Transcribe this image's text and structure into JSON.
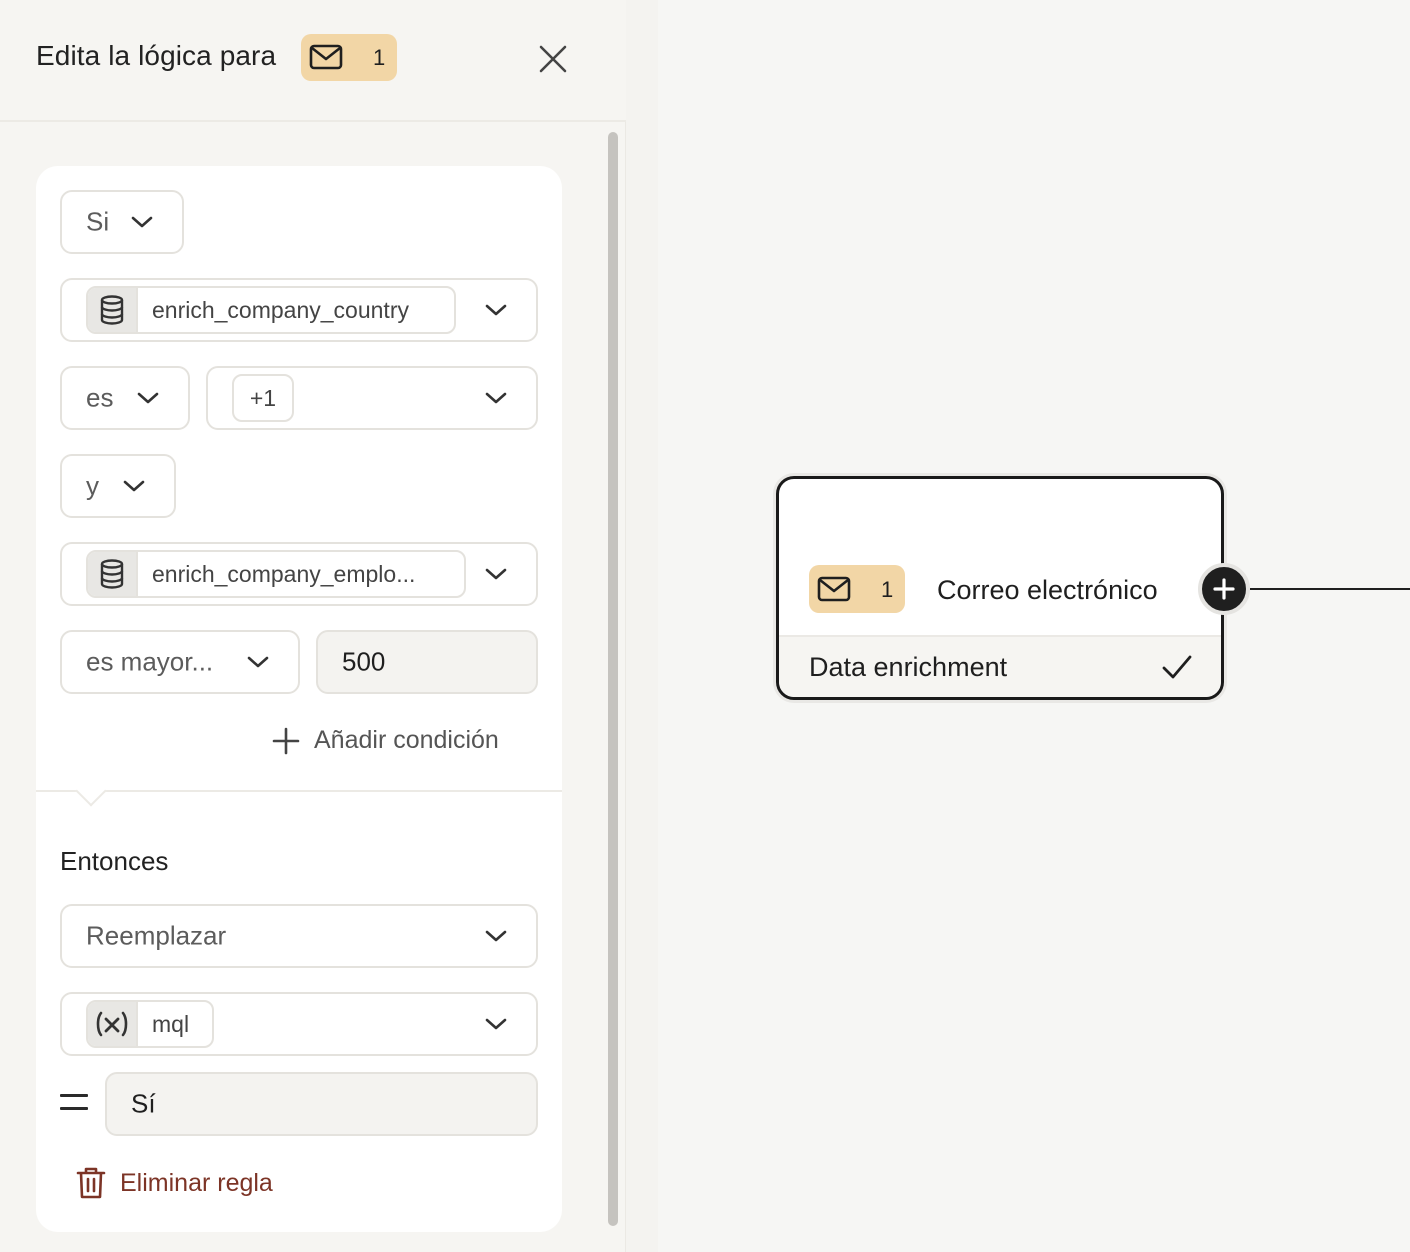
{
  "header": {
    "title": "Edita la lógica para",
    "tag": {
      "icon": "mail-icon",
      "count": "1",
      "color": "#f2d6a6"
    }
  },
  "rule": {
    "condition_keyword": "Si",
    "condition1": {
      "variable": "enrich_company_country",
      "operator": "es",
      "value_count": "+1"
    },
    "join": "y",
    "condition2": {
      "variable": "enrich_company_emplo...",
      "operator": "es mayor...",
      "value": "500"
    },
    "add_condition_label": "Añadir condición",
    "then_label": "Entonces",
    "action": "Reemplazar",
    "target_variable": "mql",
    "equals_value": "Sí",
    "delete_label": "Eliminar regla"
  },
  "node": {
    "tag_count": "1",
    "title": "Correo electrónico",
    "footer_label": "Data enrichment"
  },
  "colors": {
    "tag_bg": "#f2d6a6",
    "delete_text": "#7c3426",
    "node_border": "#1a1a1a"
  }
}
